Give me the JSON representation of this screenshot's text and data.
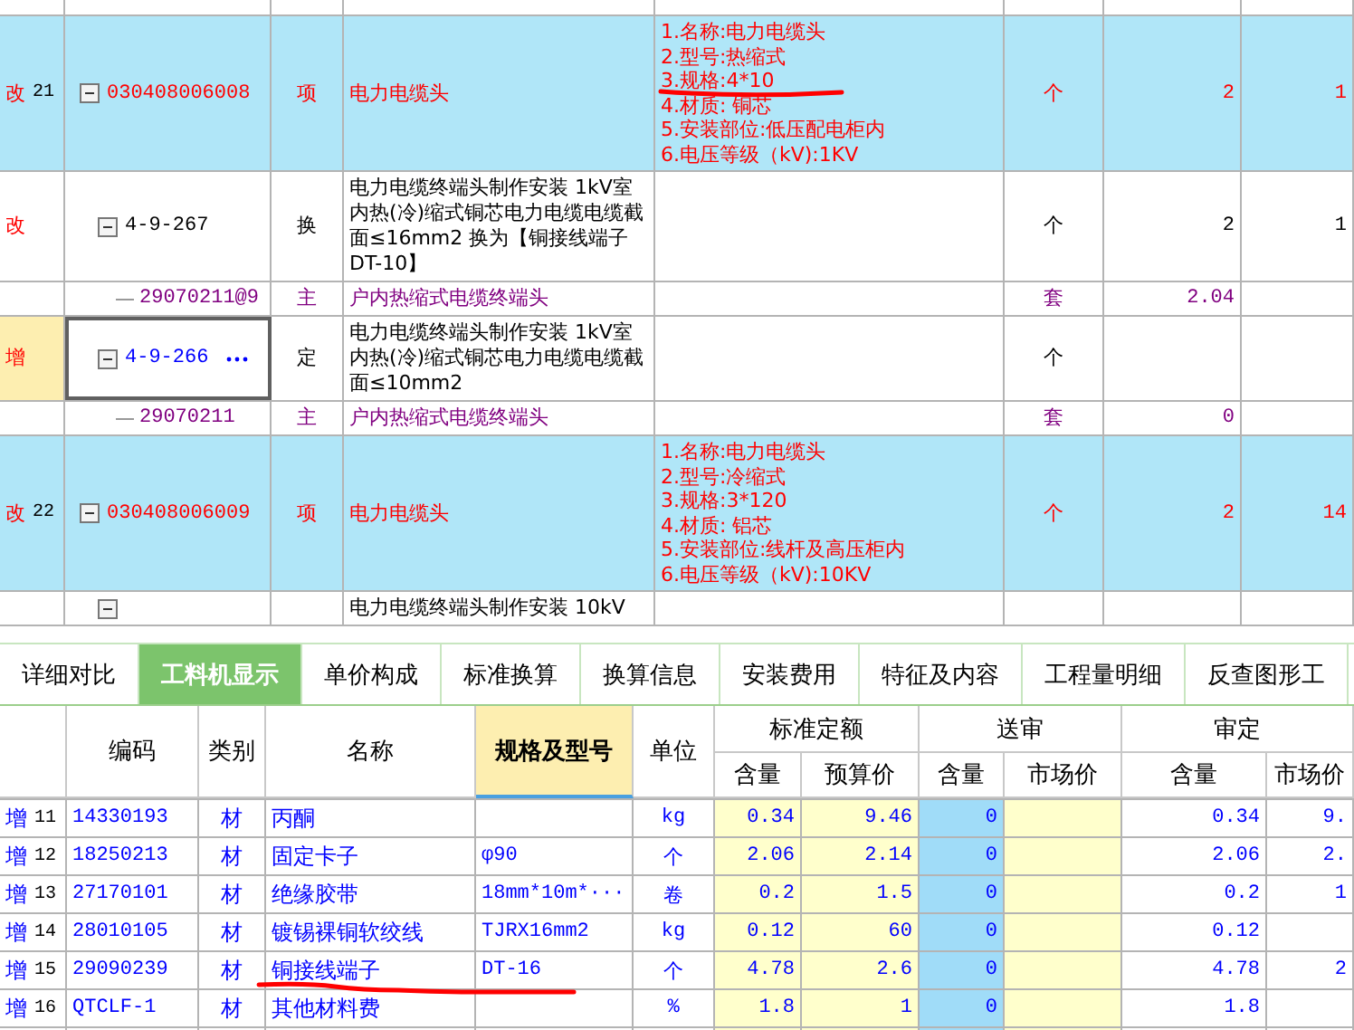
{
  "top_table": {
    "rows": [
      {
        "kind": "item",
        "status": "改",
        "index": "21",
        "code": "030408006008",
        "type": "项",
        "name": "电力电缆头",
        "features": [
          "1.名称:电力电缆头",
          "2.型号:热缩式",
          "3.规格:4*10",
          "4.材质: 铜芯",
          "5.安装部位:低压配电柜内",
          "6.电压等级（kV):1KV"
        ],
        "unit": "个",
        "quantity": "2",
        "column_9": "1",
        "selected": false,
        "expanded": true,
        "children": [
          {
            "kind": "quota",
            "status": "改",
            "code": "4-9-267",
            "type": "换",
            "name": "电力电缆终端头制作安装 1kV室内热(冷)缩式铜芯电力电缆电缆截面≤16mm2  换为【铜接线端子DT-10】",
            "unit": "个",
            "quantity": "2",
            "column_9": "1",
            "selected": false,
            "expanded": true,
            "children": [
              {
                "kind": "material",
                "code": "29070211@9",
                "type": "主",
                "name": "户内热缩式电缆终端头",
                "unit": "套",
                "quantity": "2.04",
                "selected": false
              }
            ]
          },
          {
            "kind": "quota",
            "status": "增",
            "code": "4-9-266",
            "type": "定",
            "name": "电力电缆终端头制作安装 1kV室内热(冷)缩式铜芯电力电缆电缆截面≤10mm2",
            "unit": "个",
            "selected": true,
            "expanded": true,
            "children": [
              {
                "kind": "material",
                "code": "29070211",
                "type": "主",
                "name": "户内热缩式电缆终端头",
                "unit": "套",
                "quantity": "0",
                "selected": false
              }
            ]
          }
        ]
      },
      {
        "kind": "item",
        "status": "改",
        "index": "22",
        "code": "030408006009",
        "type": "项",
        "name": "电力电缆头",
        "features": [
          "1.名称:电力电缆头",
          "2.型号:冷缩式",
          "3.规格:3*120",
          "4.材质: 铝芯",
          "5.安装部位:线杆及高压柜内",
          "6.电压等级（kV):10KV"
        ],
        "unit": "个",
        "quantity": "2",
        "column_9": "14",
        "selected": false,
        "expanded": true,
        "children": [
          {
            "kind": "quota",
            "name": "电力电缆终端头制作安装 10kV",
            "selected": false,
            "expanded": true
          }
        ]
      }
    ]
  },
  "tabs": [
    {
      "label": "详细对比",
      "selected": false
    },
    {
      "label": "工料机显示",
      "selected": true
    },
    {
      "label": "单价构成",
      "selected": false
    },
    {
      "label": "标准换算",
      "selected": false
    },
    {
      "label": "换算信息",
      "selected": false
    },
    {
      "label": "安装费用",
      "selected": false
    },
    {
      "label": "特征及内容",
      "selected": false
    },
    {
      "label": "工程量明细",
      "selected": false
    },
    {
      "label": "反查图形工",
      "selected": false
    }
  ],
  "bottom_table": {
    "columns": {
      "code": "编码",
      "category": "类别",
      "name": "名称",
      "spec": "规格及型号",
      "unit": "单位",
      "standard": "标准定额",
      "submitted": "送审",
      "approved": "审定",
      "sub_headers": [
        "含量",
        "预算价",
        "含量",
        "市场价",
        "含量",
        "市场价"
      ]
    },
    "rows": [
      {
        "status": "增",
        "index": "11",
        "code": "14330193",
        "category": "材",
        "name": "丙酮",
        "spec": "",
        "unit": "kg",
        "std_qty": "0.34",
        "std_price": "9.46",
        "sub_qty": "0",
        "app_qty": "0.34",
        "app_price": "9."
      },
      {
        "status": "增",
        "index": "12",
        "code": "18250213",
        "category": "材",
        "name": "固定卡子",
        "spec": "φ90",
        "unit": "个",
        "std_qty": "2.06",
        "std_price": "2.14",
        "sub_qty": "0",
        "app_qty": "2.06",
        "app_price": "2."
      },
      {
        "status": "增",
        "index": "13",
        "code": "27170101",
        "category": "材",
        "name": "绝缘胶带",
        "spec": "18mm*10m*···",
        "unit": "卷",
        "std_qty": "0.2",
        "std_price": "1.5",
        "sub_qty": "0",
        "app_qty": "0.2",
        "app_price": "1"
      },
      {
        "status": "增",
        "index": "14",
        "code": "28010105",
        "category": "材",
        "name": "镀锡裸铜软绞线",
        "spec": "TJRX16mm2",
        "unit": "kg",
        "std_qty": "0.12",
        "std_price": "60",
        "sub_qty": "0",
        "app_qty": "0.12",
        "app_price": ""
      },
      {
        "status": "增",
        "index": "15",
        "code": "29090239",
        "category": "材",
        "name": "铜接线端子",
        "spec": "DT-16",
        "unit": "个",
        "std_qty": "4.78",
        "std_price": "2.6",
        "sub_qty": "0",
        "app_qty": "4.78",
        "app_price": "2"
      },
      {
        "status": "增",
        "index": "16",
        "code": "QTCLF-1",
        "category": "材",
        "name": "其他材料费",
        "spec": "",
        "unit": "%",
        "std_qty": "1.8",
        "std_price": "1",
        "sub_qty": "0",
        "app_qty": "1.8",
        "app_price": ""
      }
    ]
  }
}
